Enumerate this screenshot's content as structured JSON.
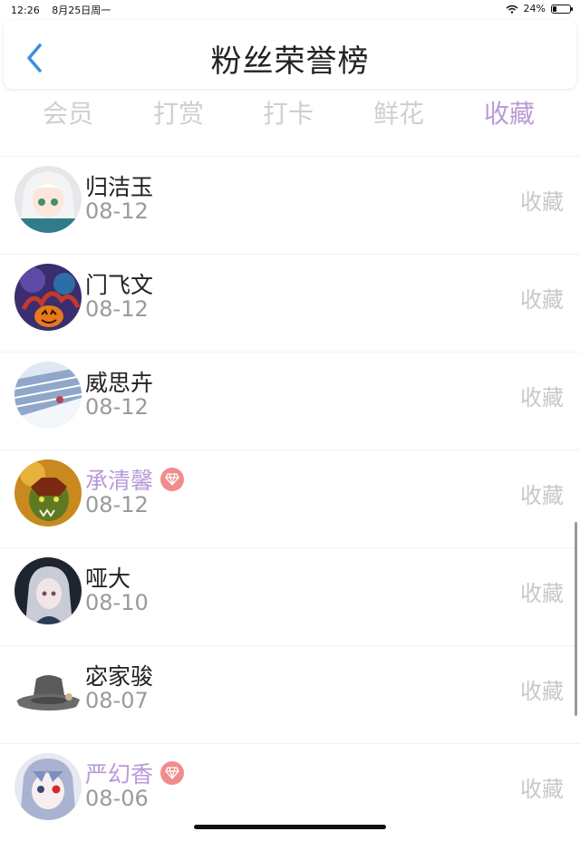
{
  "status_bar": {
    "time": "12:26",
    "date": "8月25日周一",
    "battery": "24%",
    "battery_level": 0.24
  },
  "header": {
    "title": "粉丝荣誉榜"
  },
  "tabs": [
    {
      "label": "会员",
      "active": false
    },
    {
      "label": "打赏",
      "active": false
    },
    {
      "label": "打卡",
      "active": false
    },
    {
      "label": "鲜花",
      "active": false
    },
    {
      "label": "收藏",
      "active": true
    }
  ],
  "rows": [
    {
      "name": "归洁玉",
      "date": "08-12",
      "action": "收藏",
      "vip": false,
      "avatar": "anime-girl-white-hair"
    },
    {
      "name": "门飞文",
      "date": "08-12",
      "action": "收藏",
      "vip": false,
      "avatar": "pumpkin-octopus"
    },
    {
      "name": "威思卉",
      "date": "08-12",
      "action": "收藏",
      "vip": false,
      "avatar": "piano-keys"
    },
    {
      "name": "承清馨",
      "date": "08-12",
      "action": "收藏",
      "vip": true,
      "avatar": "orc-warrior"
    },
    {
      "name": "哑大",
      "date": "08-10",
      "action": "收藏",
      "vip": false,
      "avatar": "anime-girl-dark"
    },
    {
      "name": "宓家骏",
      "date": "08-07",
      "action": "收藏",
      "vip": false,
      "avatar": "grey-fedora-hat"
    },
    {
      "name": "严幻香",
      "date": "08-06",
      "action": "收藏",
      "vip": true,
      "avatar": "anime-girl-red-eye"
    }
  ],
  "colors": {
    "accent": "#b99ad8",
    "inactive_tab": "#cfcfcf",
    "vip_badge": "#f08c8c",
    "back_arrow": "#3a8fe0"
  }
}
